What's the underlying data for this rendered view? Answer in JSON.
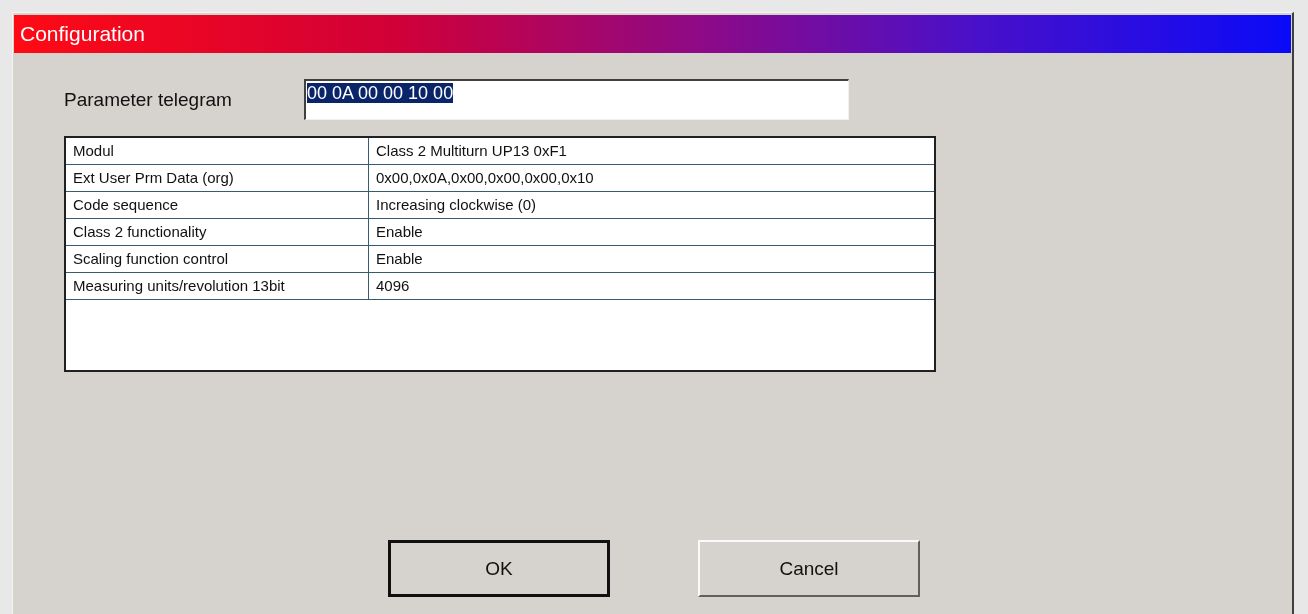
{
  "window": {
    "title": "Configuration"
  },
  "parameter_telegram": {
    "label": "Parameter telegram",
    "value": "00 0A 00 00 10 00",
    "value_selected": true
  },
  "table": {
    "rows": [
      {
        "name": "Modul",
        "value": "Class 2 Multiturn UP13 0xF1"
      },
      {
        "name": "Ext User Prm Data (org)",
        "value": " 0x00,0x0A,0x00,0x00,0x00,0x10"
      },
      {
        "name": "Code sequence",
        "value": "Increasing clockwise (0)"
      },
      {
        "name": "Class 2 functionality",
        "value": "Enable"
      },
      {
        "name": "Scaling function control",
        "value": "Enable"
      },
      {
        "name": "Measuring units/revolution 13bit",
        "value": "4096"
      }
    ]
  },
  "buttons": [
    {
      "label": "OK",
      "default": true
    },
    {
      "label": "Cancel",
      "default": false
    }
  ]
}
